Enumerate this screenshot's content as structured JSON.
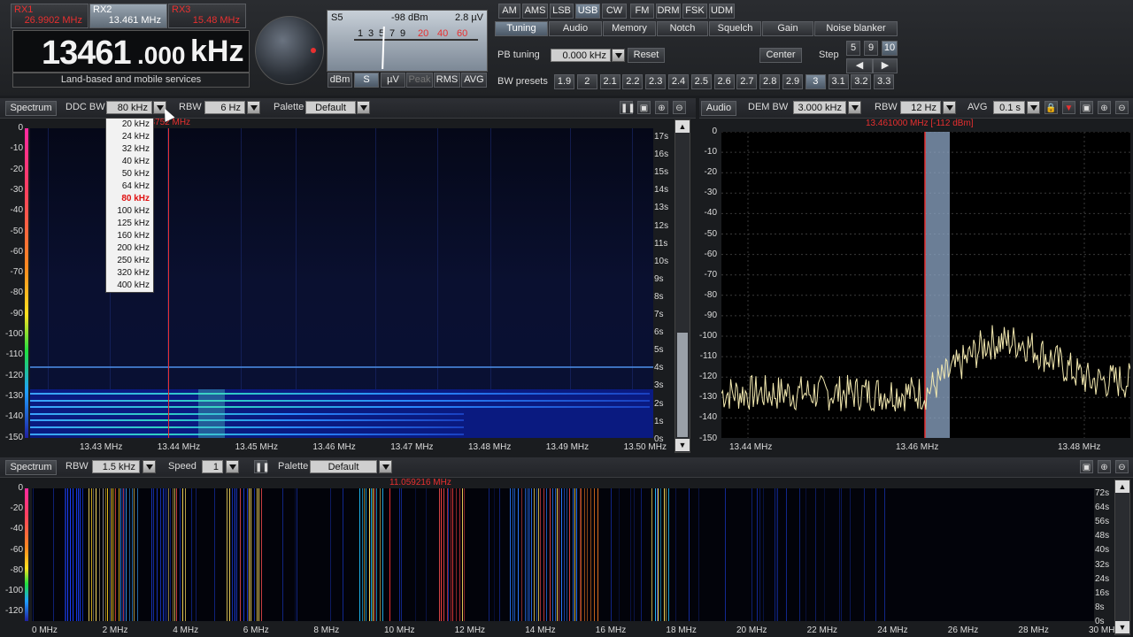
{
  "receivers": [
    {
      "label": "RX1",
      "freq": "26.9902 MHz"
    },
    {
      "label": "RX2",
      "freq": "13.461 MHz"
    },
    {
      "label": "RX3",
      "freq": "15.48 MHz"
    }
  ],
  "main_freq": {
    "digits": "13461",
    "decimals": ".000",
    "unit": "kHz",
    "service": "Land-based and mobile services"
  },
  "smeter": {
    "s_label": "S5",
    "dbm": "-98 dBm",
    "uv": "2.8 µV",
    "scale": [
      "1",
      "3",
      "5",
      "7",
      "9",
      "20",
      "40",
      "60"
    ],
    "units": [
      "dBm",
      "S",
      "µV"
    ],
    "modes": [
      "Peak",
      "RMS",
      "AVG"
    ]
  },
  "modes": [
    "AM",
    "AMS",
    "LSB",
    "USB",
    "CW",
    "FM",
    "DRM",
    "FSK",
    "UDM"
  ],
  "active_mode": "USB",
  "tabs": [
    "Tuning",
    "Audio",
    "Memory",
    "Notch",
    "Squelch",
    "Gain",
    "Noise blanker"
  ],
  "pb_tuning": {
    "label": "PB tuning",
    "value": "0.000 kHz",
    "reset": "Reset"
  },
  "center": "Center",
  "step": {
    "label": "Step",
    "values": [
      "5",
      "9",
      "10"
    ]
  },
  "bw_presets": {
    "label": "BW presets",
    "values": [
      "1.9",
      "2",
      "2.1",
      "2.2",
      "2.3",
      "2.4",
      "2.5",
      "2.6",
      "2.7",
      "2.8",
      "2.9",
      "3",
      "3.1",
      "3.2",
      "3.3"
    ],
    "active": "3"
  },
  "ddc": {
    "spectrum": "Spectrum",
    "ddc_bw_label": "DDC BW",
    "ddc_bw": "80 kHz",
    "rbw_label": "RBW",
    "rbw": "6 Hz",
    "palette_label": "Palette",
    "palette": "Default",
    "cursor": "13.43752 MHz",
    "options": [
      "20 kHz",
      "24 kHz",
      "32 kHz",
      "40 kHz",
      "50 kHz",
      "64 kHz",
      "80 kHz",
      "100 kHz",
      "125 kHz",
      "160 kHz",
      "200 kHz",
      "250 kHz",
      "320 kHz",
      "400 kHz"
    ],
    "y_ticks": [
      "0",
      "-10",
      "-20",
      "-30",
      "-40",
      "-50",
      "-60",
      "-70",
      "-80",
      "-90",
      "-100",
      "-110",
      "-120",
      "-130",
      "-140",
      "-150"
    ],
    "x_ticks": [
      "13.43 MHz",
      "13.44 MHz",
      "13.45 MHz",
      "13.46 MHz",
      "13.47 MHz",
      "13.48 MHz",
      "13.49 MHz",
      "13.50 MHz"
    ],
    "time_ticks": [
      "17s",
      "16s",
      "15s",
      "14s",
      "13s",
      "12s",
      "11s",
      "10s",
      "9s",
      "8s",
      "7s",
      "6s",
      "5s",
      "4s",
      "3s",
      "2s",
      "1s",
      "0s"
    ]
  },
  "audio": {
    "audio_label": "Audio",
    "dem_bw_label": "DEM BW",
    "dem_bw": "3.000 kHz",
    "rbw_label": "RBW",
    "rbw": "12 Hz",
    "avg_label": "AVG",
    "avg": "0.1 s",
    "marker": "13.461000 MHz [-112 dBm]",
    "y_ticks": [
      "0",
      "-10",
      "-20",
      "-30",
      "-40",
      "-50",
      "-60",
      "-70",
      "-80",
      "-90",
      "-100",
      "-110",
      "-120",
      "-130",
      "-140",
      "-150"
    ],
    "x_ticks": [
      "13.44 MHz",
      "13.46 MHz",
      "13.48 MHz"
    ]
  },
  "wide": {
    "spectrum": "Spectrum",
    "rbw_label": "RBW",
    "rbw": "1.5 kHz",
    "speed_label": "Speed",
    "speed": "1",
    "palette_label": "Palette",
    "palette": "Default",
    "cursor": "11.059216 MHz",
    "y_ticks": [
      "0",
      "-20",
      "-40",
      "-60",
      "-80",
      "-100",
      "-120"
    ],
    "x_ticks": [
      "0 MHz",
      "2 MHz",
      "4 MHz",
      "6 MHz",
      "8 MHz",
      "10 MHz",
      "12 MHz",
      "14 MHz",
      "16 MHz",
      "18 MHz",
      "20 MHz",
      "22 MHz",
      "24 MHz",
      "26 MHz",
      "28 MHz",
      "30 MHz"
    ],
    "time_ticks": [
      "72s",
      "64s",
      "56s",
      "48s",
      "40s",
      "32s",
      "24s",
      "16s",
      "8s",
      "0s"
    ]
  },
  "colors": {
    "accent_red": "#e83030",
    "trace": "#f4eab0",
    "highlight": "#8fa8c8"
  }
}
